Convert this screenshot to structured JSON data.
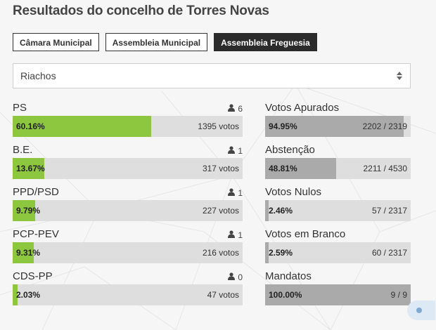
{
  "title": "Resultados do concelho de Torres Novas",
  "tabs": [
    {
      "label": "Câmara Municipal",
      "active": false
    },
    {
      "label": "Assembleia Municipal",
      "active": false
    },
    {
      "label": "Assembleia Freguesia",
      "active": true
    }
  ],
  "parish_select": {
    "value": "Riachos"
  },
  "colors": {
    "party_bar": "#8dc63f",
    "stat_bar": "#aaaaaa",
    "track": "#dedede"
  },
  "parties": [
    {
      "name": "PS",
      "seats": "6",
      "pct_label": "60.16%",
      "pct": 60.16,
      "votes": "1395 votos"
    },
    {
      "name": "B.E.",
      "seats": "1",
      "pct_label": "13.67%",
      "pct": 13.67,
      "votes": "317 votos"
    },
    {
      "name": "PPD/PSD",
      "seats": "1",
      "pct_label": "9.79%",
      "pct": 9.79,
      "votes": "227 votos"
    },
    {
      "name": "PCP-PEV",
      "seats": "1",
      "pct_label": "9.31%",
      "pct": 9.31,
      "votes": "216 votos"
    },
    {
      "name": "CDS-PP",
      "seats": "0",
      "pct_label": "2.03%",
      "pct": 2.03,
      "votes": "47 votos"
    }
  ],
  "stats": [
    {
      "name": "Votos Apurados",
      "pct_label": "94.95%",
      "pct": 94.95,
      "ratio": "2202 / 2319"
    },
    {
      "name": "Abstenção",
      "pct_label": "48.81%",
      "pct": 48.81,
      "ratio": "2211 / 4530"
    },
    {
      "name": "Votos Nulos",
      "pct_label": "2.46%",
      "pct": 2.46,
      "ratio": "57 / 2317"
    },
    {
      "name": "Votos em Branco",
      "pct_label": "2.59%",
      "pct": 2.59,
      "ratio": "60 / 2317"
    },
    {
      "name": "Mandatos",
      "pct_label": "100.00%",
      "pct": 100.0,
      "ratio": "9 / 9"
    }
  ]
}
